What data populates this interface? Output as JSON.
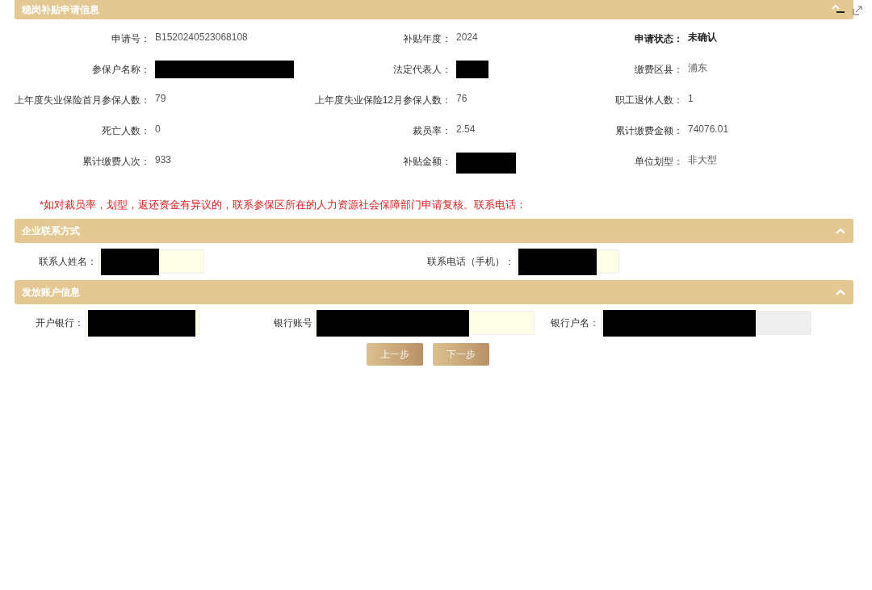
{
  "sections": [
    {
      "kind": "info",
      "title": "稳岗补贴申请信息",
      "expanded": true,
      "fields": [
        {
          "label": "申请号：",
          "value": "B1520240523068108"
        },
        {
          "label": "补贴年度：",
          "value": "2024"
        },
        {
          "label": "申请状态：",
          "value": "未确认",
          "bold": true
        },
        {
          "label": "参保户名称：",
          "redacted": true
        },
        {
          "label": "法定代表人：",
          "redacted": true
        },
        {
          "label": "缴费区县：",
          "value": "浦东"
        },
        {
          "label": "上年度失业保险首月参保人数：",
          "value": "79"
        },
        {
          "label": "上年度失业保险12月参保人数：",
          "value": "76"
        },
        {
          "label": "职工退休人数：",
          "value": "1"
        },
        {
          "label": "死亡人数：",
          "value": "0"
        },
        {
          "label": "裁员率：",
          "value": "2.54"
        },
        {
          "label": "累计缴费金额：",
          "value": "74076.01"
        },
        {
          "label": "累计缴费人次：",
          "value": "933"
        },
        {
          "label": "补贴金额：",
          "redacted": true
        },
        {
          "label": "单位划型：",
          "value": "非大型"
        }
      ],
      "notice": "*如对裁员率，划型，返还资金有异议的，联系参保区所在的人力资源社会保障部门申请复核。联系电话："
    },
    {
      "kind": "form",
      "title": "企业联系方式",
      "expanded": true,
      "fields": [
        {
          "label": "联系人姓名：",
          "redacted": true,
          "disabled": false
        },
        {
          "label": "联系电话（手机）：",
          "redacted": true,
          "disabled": false
        }
      ]
    },
    {
      "kind": "form",
      "title": "发放账户信息",
      "expanded": true,
      "fields": [
        {
          "label": "开户银行：",
          "redacted": true,
          "disabled": false
        },
        {
          "label": "银行账号",
          "redacted": true,
          "disabled": false
        },
        {
          "label": "银行户名：",
          "redacted": true,
          "disabled": true
        }
      ]
    }
  ],
  "buttons": [
    "上一步",
    "下一步"
  ]
}
